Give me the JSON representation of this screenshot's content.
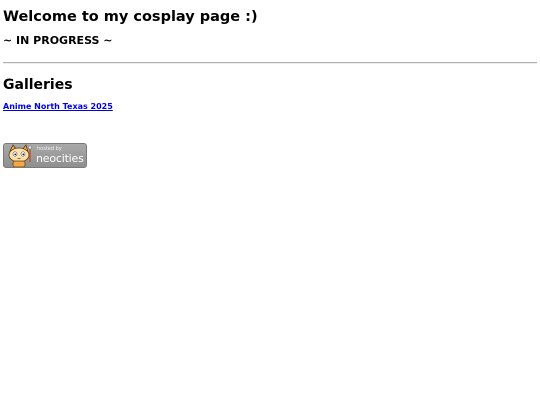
{
  "header": {
    "title": "Welcome to my cosplay page :)",
    "status": "~ IN PROGRESS ~"
  },
  "galleries": {
    "heading": "Galleries",
    "links": [
      {
        "label": "Anime North Texas 2025"
      }
    ]
  },
  "footer": {
    "badge": {
      "icon": "neocities-cat-icon",
      "hosted_text": "hosted by",
      "brand_text": "neocities"
    }
  },
  "colors": {
    "link": "#0000ee",
    "badge_background": "#999999"
  }
}
